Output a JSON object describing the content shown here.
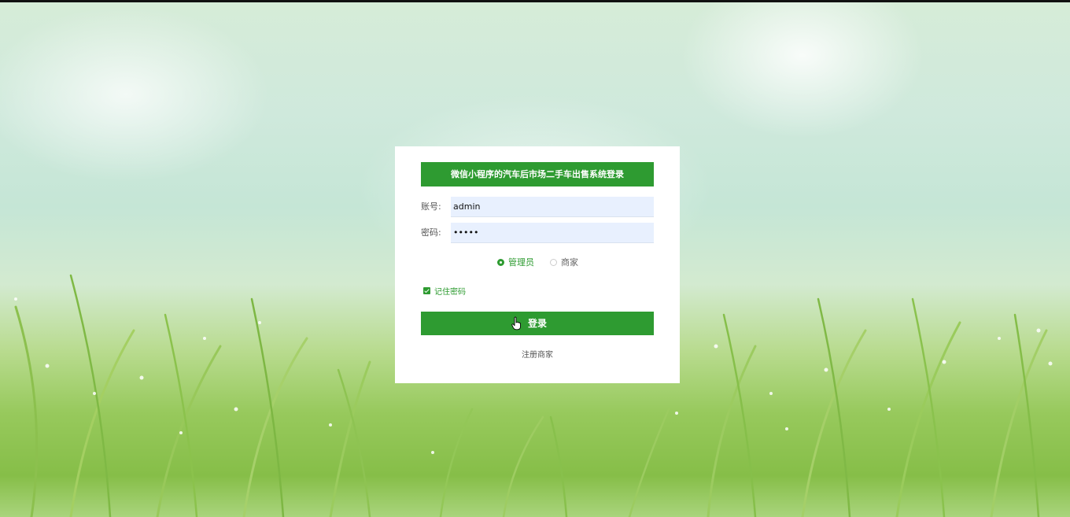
{
  "title": "微信小程序的汽车后市场二手车出售系统登录",
  "form": {
    "account_label": "账号:",
    "account_value": "admin",
    "password_label": "密码:",
    "password_value": "•••••"
  },
  "roles": {
    "options": [
      "管理员",
      "商家"
    ],
    "selected": "管理员"
  },
  "remember_label": "记住密码",
  "login_label": "登录",
  "register_label": "注册商家",
  "colors": {
    "accent": "#2e9b31"
  }
}
